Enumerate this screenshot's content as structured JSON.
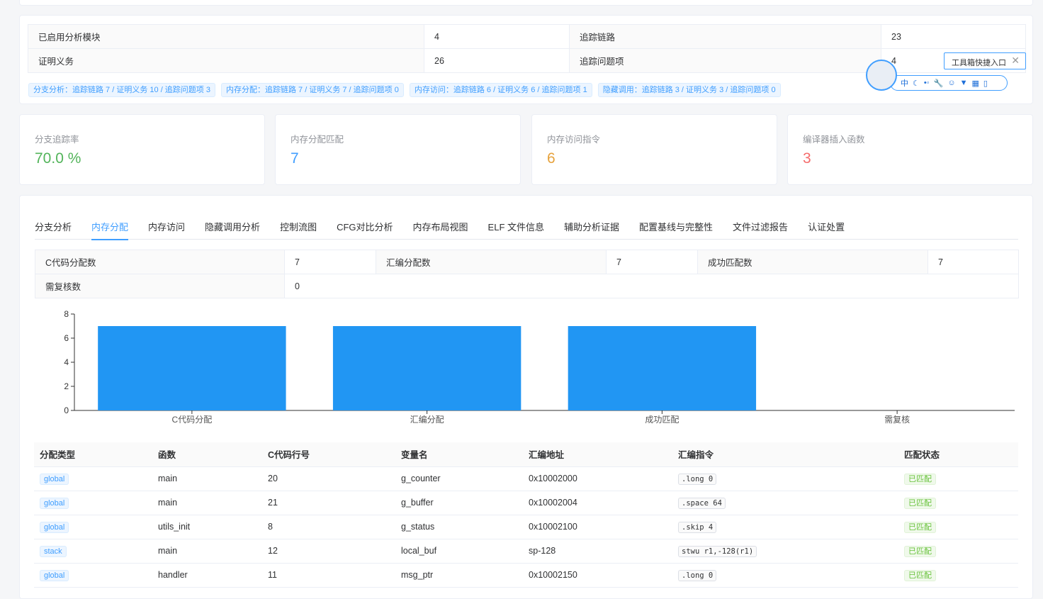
{
  "summary": {
    "rows": [
      {
        "l1": "已启用分析模块",
        "v1": "4",
        "l2": "追踪链路",
        "v2": "23"
      },
      {
        "l1": "证明义务",
        "v1": "26",
        "l2": "追踪问题项",
        "v2": "4"
      }
    ],
    "tags": [
      "分支分析：追踪链路 7 / 证明义务 10 / 追踪问题项 3",
      "内存分配：追踪链路 7 / 证明义务 7 / 追踪问题项 0",
      "内存访问：追踪链路 6 / 证明义务 6 / 追踪问题项 1",
      "隐藏调用：追踪链路 3 / 证明义务 3 / 追踪问题项 0"
    ]
  },
  "stats": [
    {
      "title": "分支追踪率",
      "value": "70.0 %",
      "color": "#52b45a"
    },
    {
      "title": "内存分配匹配",
      "value": "7",
      "color": "#409eff"
    },
    {
      "title": "内存访问指令",
      "value": "6",
      "color": "#e6a23c"
    },
    {
      "title": "编译器插入函数",
      "value": "3",
      "color": "#f56c6c"
    }
  ],
  "tabs": [
    "分支分析",
    "内存分配",
    "内存访问",
    "隐藏调用分析",
    "控制流图",
    "CFG对比分析",
    "内存布局视图",
    "ELF 文件信息",
    "辅助分析证据",
    "配置基线与完整性",
    "文件过滤报告",
    "认证处置"
  ],
  "detail": {
    "r1": {
      "l1": "C代码分配数",
      "v1": "7",
      "l2": "汇编分配数",
      "v2": "7",
      "l3": "成功匹配数",
      "v3": "7"
    },
    "r2": {
      "l1": "需复核数",
      "v1": "0"
    }
  },
  "chart_data": {
    "type": "bar",
    "categories": [
      "C代码分配",
      "汇编分配",
      "成功匹配",
      "需复核"
    ],
    "values": [
      7,
      7,
      7,
      0
    ],
    "ylim": [
      0,
      8
    ],
    "yticks": [
      0,
      2,
      4,
      6,
      8
    ],
    "color": "#2196f3"
  },
  "table": {
    "headers": [
      "分配类型",
      "函数",
      "C代码行号",
      "变量名",
      "汇编地址",
      "汇编指令",
      "匹配状态"
    ],
    "rows": [
      [
        "global",
        "main",
        "20",
        "g_counter",
        "0x10002000",
        ".long 0",
        "已匹配"
      ],
      [
        "global",
        "main",
        "21",
        "g_buffer",
        "0x10002004",
        ".space 64",
        "已匹配"
      ],
      [
        "global",
        "utils_init",
        "8",
        "g_status",
        "0x10002100",
        ".skip 4",
        "已匹配"
      ],
      [
        "stack",
        "main",
        "12",
        "local_buf",
        "sp-128",
        "stwu r1,-128(r1)",
        "已匹配"
      ],
      [
        "global",
        "handler",
        "11",
        "msg_ptr",
        "0x10002150",
        ".long 0",
        "已匹配"
      ]
    ]
  },
  "ime": {
    "tip": "工具箱快捷入口",
    "lang": "中"
  }
}
